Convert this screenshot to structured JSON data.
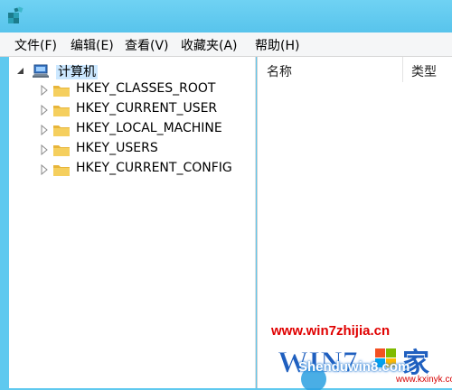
{
  "menu": {
    "file": "文件(F)",
    "edit": "编辑(E)",
    "view": "查看(V)",
    "favorites": "收藏夹(A)",
    "help": "帮助(H)"
  },
  "tree": {
    "root": "计算机",
    "items": [
      {
        "label": "HKEY_CLASSES_ROOT"
      },
      {
        "label": "HKEY_CURRENT_USER"
      },
      {
        "label": "HKEY_LOCAL_MACHINE"
      },
      {
        "label": "HKEY_USERS"
      },
      {
        "label": "HKEY_CURRENT_CONFIG"
      }
    ]
  },
  "list": {
    "columns": [
      "名称",
      "类型"
    ]
  },
  "watermark": {
    "url": "www.win7zhijia.cn",
    "brand": "Shenduwin8.com",
    "site": "www.kxinyk.com"
  },
  "colors": {
    "titlebar": "#5fc9ef",
    "folder": "#e8b53a",
    "selection": "#cce8ff",
    "watermark_red": "#e00000"
  },
  "icons": [
    "regedit-icon",
    "computer-icon",
    "folder-icon",
    "expander-icon",
    "windows-logo-icon"
  ]
}
